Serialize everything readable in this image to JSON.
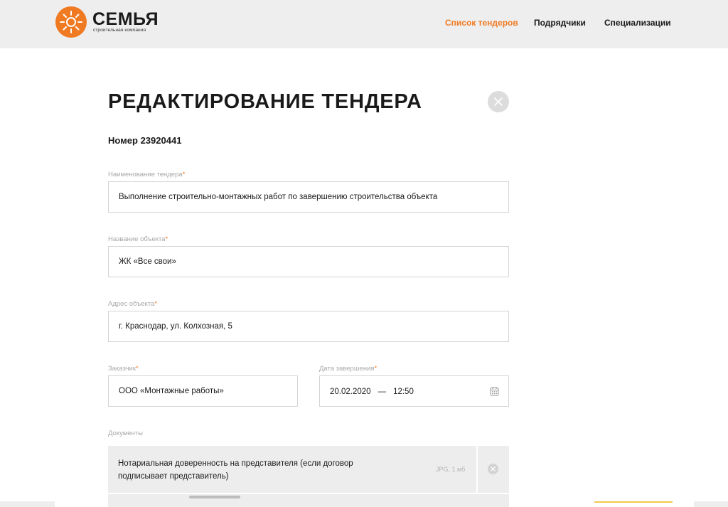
{
  "brand": {
    "name": "СЕМЬЯ",
    "tagline": "строительная компания",
    "accent_color": "#f07a22"
  },
  "nav": {
    "items": [
      {
        "label": "Список тендеров",
        "active": true
      },
      {
        "label": "Подрядчики",
        "active": false
      },
      {
        "label": "Специализации",
        "active": false
      }
    ]
  },
  "form": {
    "title": "РЕДАКТИРОВАНИЕ ТЕНДЕРА",
    "number_label": "Номер",
    "number_value": "23920441",
    "fields": {
      "tender_name": {
        "label": "Наименование тендера",
        "required": "*",
        "value": "Выполнение строительно-монтажных работ по завершению строительства объекта"
      },
      "object_name": {
        "label": "Название объекта",
        "required": "*",
        "value": "ЖК «Все свои»"
      },
      "object_address": {
        "label": "Адрес объекта",
        "required": "*",
        "value": "г. Краснодар, ул. Колхозная, 5"
      },
      "customer": {
        "label": "Заказчик",
        "required": "*",
        "value": "ООО «Монтажные работы»"
      },
      "completion_date": {
        "label": "Дата завершения",
        "required": "*",
        "date": "20.02.2020",
        "separator": "—",
        "time": "12:50"
      }
    },
    "documents": {
      "label": "Документы",
      "items": [
        {
          "name": "Нотариальная доверенность на представителя (если договор подписывает представитель)",
          "meta": "JPG, 1 мб"
        }
      ]
    }
  },
  "icons": {
    "close": "close-icon",
    "calendar": "calendar-icon",
    "remove": "remove-icon",
    "logo": "sun-logo-icon"
  }
}
